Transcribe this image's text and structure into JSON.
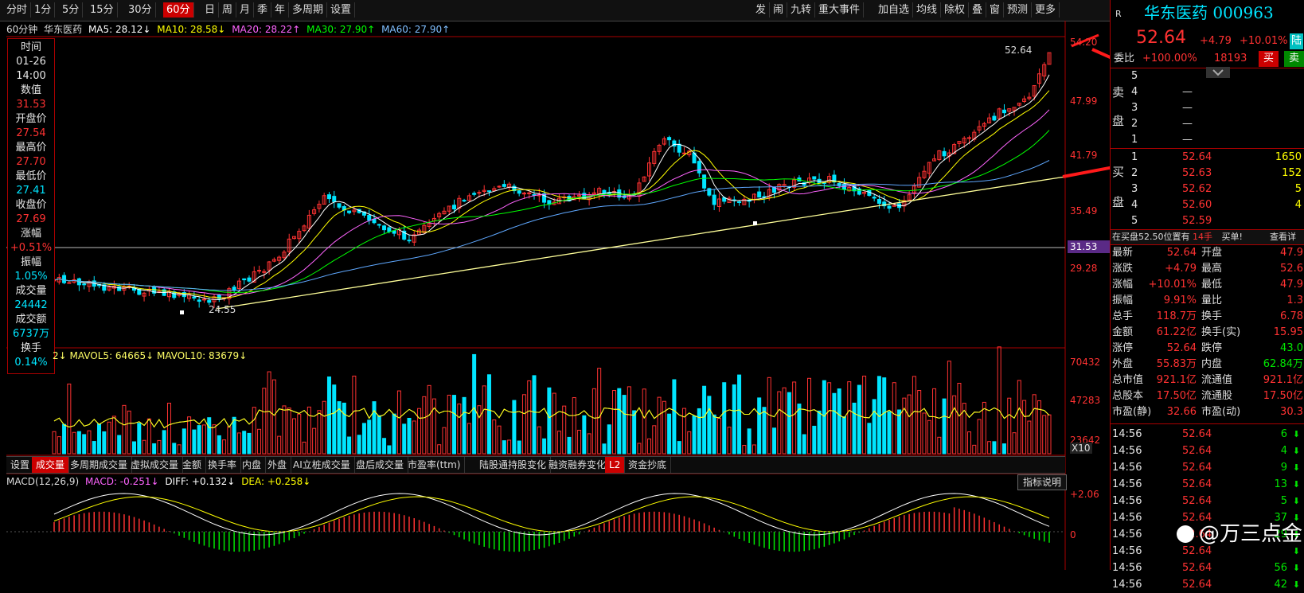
{
  "toolbar": {
    "periods": [
      "分时",
      "1分",
      "5分",
      "15分",
      "30分",
      "60分",
      "日",
      "周",
      "月",
      "季",
      "年",
      "多周期",
      "设置"
    ],
    "active_period": "60分",
    "right_buttons": [
      "发",
      "闹",
      "九转",
      "重大事件",
      "加自选",
      "均线",
      "除权",
      "叠",
      "窗",
      "预测",
      "更多"
    ]
  },
  "chart_header": {
    "period": "60分钟",
    "stock_name": "华东医药",
    "ma5": "MA5: 28.12↓",
    "ma10": "MA10: 28.58↓",
    "ma20": "MA20: 28.22↑",
    "ma30": "MA30: 27.90↑",
    "ma60": "MA60: 27.90↑"
  },
  "info_box": [
    {
      "label": "时间",
      "value": "01-26",
      "value2": "14:00"
    },
    {
      "label": "数值",
      "value": "31.53"
    },
    {
      "label": "开盘价",
      "value": "27.54"
    },
    {
      "label": "最高价",
      "value": "27.70"
    },
    {
      "label": "最低价",
      "value": "27.41"
    },
    {
      "label": "收盘价",
      "value": "27.69"
    },
    {
      "label": "涨幅",
      "value": "+0.51%"
    },
    {
      "label": "振幅",
      "value": "1.05%"
    },
    {
      "label": "成交量",
      "value": "24442"
    },
    {
      "label": "成交额",
      "value": "6737万"
    },
    {
      "label": "换手",
      "value": "0.14%"
    }
  ],
  "price_axis": {
    "ticks": [
      "54.20",
      "47.99",
      "41.79",
      "35.49",
      "29.28"
    ],
    "cursor_value": "31.53",
    "high_label": "52.64",
    "low_label": "24.55"
  },
  "volume": {
    "header": "2↓ MAVOL5: 64665↓ MAVOL10: 83679↓",
    "ticks": [
      "70432",
      "47283",
      "23642"
    ],
    "unit": "X10"
  },
  "bottom_tabs": [
    "设置",
    "成交量",
    "多周期成交量",
    "虚拟成交量",
    "金额",
    "换手率",
    "内盘",
    "外盘",
    "AI立桩成交量",
    "盘后成交量",
    "市盈率(ttm)",
    "陆股通持股变化",
    "融资融券变化",
    "L2",
    "资金抄底"
  ],
  "active_tab": "成交量",
  "macd": {
    "label": "MACD(12,26,9)",
    "macd": "MACD: -0.251↓",
    "diff": "DIFF: +0.132↓",
    "dea": "DEA: +0.258↓",
    "button": "指标说明",
    "ticks": [
      "+2.06",
      "0"
    ]
  },
  "quote": {
    "title": "华东医药 000963",
    "r_label": "R",
    "price": "52.64",
    "change": "+4.79",
    "pct": "+10.01%",
    "tag": "陆",
    "weibi_label": "委比",
    "weibi": "+100.00%",
    "weicha": "18193",
    "buy_btn": "买",
    "sell_btn": "卖",
    "sell_side_label": [
      "卖",
      "盘"
    ],
    "buy_side_label": [
      "买",
      "盘"
    ],
    "sell_levels": [
      {
        "lvl": "5",
        "price": "",
        "vol": ""
      },
      {
        "lvl": "4",
        "price": "—",
        "vol": ""
      },
      {
        "lvl": "3",
        "price": "—",
        "vol": ""
      },
      {
        "lvl": "2",
        "price": "—",
        "vol": ""
      },
      {
        "lvl": "1",
        "price": "—",
        "vol": ""
      }
    ],
    "buy_levels": [
      {
        "lvl": "1",
        "price": "52.64",
        "vol": "1650"
      },
      {
        "lvl": "2",
        "price": "52.63",
        "vol": "152"
      },
      {
        "lvl": "3",
        "price": "52.62",
        "vol": "5"
      },
      {
        "lvl": "4",
        "price": "52.60",
        "vol": "4"
      },
      {
        "lvl": "5",
        "price": "52.59",
        "vol": ""
      }
    ],
    "notice": "在买盘52.50位置有",
    "notice_qty": "14手",
    "notice_action": "买单!",
    "notice_link": "查看详",
    "stats": [
      [
        "最新",
        "52.64",
        "开盘",
        "47.9"
      ],
      [
        "涨跌",
        "+4.79",
        "最高",
        "52.6"
      ],
      [
        "涨幅",
        "+10.01%",
        "最低",
        "47.9"
      ],
      [
        "振幅",
        "9.91%",
        "量比",
        "1.3"
      ],
      [
        "总手",
        "118.7万",
        "换手",
        "6.78"
      ],
      [
        "金额",
        "61.22亿",
        "换手(实)",
        "15.95"
      ],
      [
        "涨停",
        "52.64",
        "跌停",
        "43.0"
      ],
      [
        "外盘",
        "55.83万",
        "内盘",
        "62.84万"
      ],
      [
        "总市值",
        "921.1亿",
        "流通值",
        "921.1亿"
      ],
      [
        "总股本",
        "17.50亿",
        "流通股",
        "17.50亿"
      ],
      [
        "市盈(静)",
        "32.66",
        "市盈(动)",
        "30.3"
      ]
    ],
    "ticks": [
      {
        "time": "14:56",
        "price": "52.64",
        "vol": "6"
      },
      {
        "time": "14:56",
        "price": "52.64",
        "vol": "4"
      },
      {
        "time": "14:56",
        "price": "52.64",
        "vol": "9"
      },
      {
        "time": "14:56",
        "price": "52.64",
        "vol": "13"
      },
      {
        "time": "14:56",
        "price": "52.64",
        "vol": "5"
      },
      {
        "time": "14:56",
        "price": "52.64",
        "vol": "37"
      },
      {
        "time": "14:56",
        "price": "52.64",
        "vol": "29"
      },
      {
        "time": "14:56",
        "price": "52.64",
        "vol": ""
      },
      {
        "time": "14:56",
        "price": "52.64",
        "vol": "56"
      },
      {
        "time": "14:56",
        "price": "52.64",
        "vol": "42"
      }
    ]
  },
  "watermark": "@万三点金",
  "colors": {
    "up": "#ff3232",
    "down": "#00e5ff",
    "accent": "#aa0000"
  }
}
